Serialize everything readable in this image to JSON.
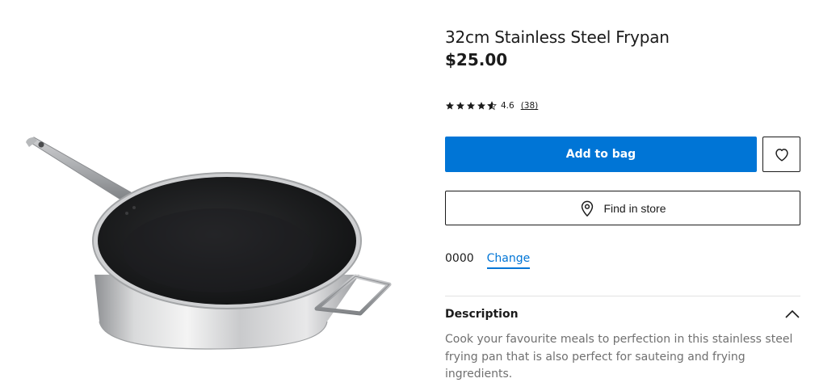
{
  "product": {
    "title": "32cm Stainless Steel Frypan",
    "price": "$25.00",
    "rating_value": "4.6",
    "rating_count": "(38)",
    "rating_stars": 4.6,
    "image_icon": "frypan-image"
  },
  "actions": {
    "add_to_bag_label": "Add to bag",
    "find_in_store_label": "Find in store",
    "wishlist_icon": "heart-icon",
    "store_icon": "location-pin-icon"
  },
  "location": {
    "postcode": "0000",
    "change_label": "Change"
  },
  "description": {
    "heading": "Description",
    "body": "Cook your favourite meals to perfection in this stainless steel frying pan that is also perfect for sauteing and frying ingredients.",
    "toggle_icon": "chevron-up-icon"
  },
  "colors": {
    "accent": "#0075d6",
    "text": "#1b1b1b",
    "muted_text": "#707070",
    "divider": "#e2e2e2"
  }
}
